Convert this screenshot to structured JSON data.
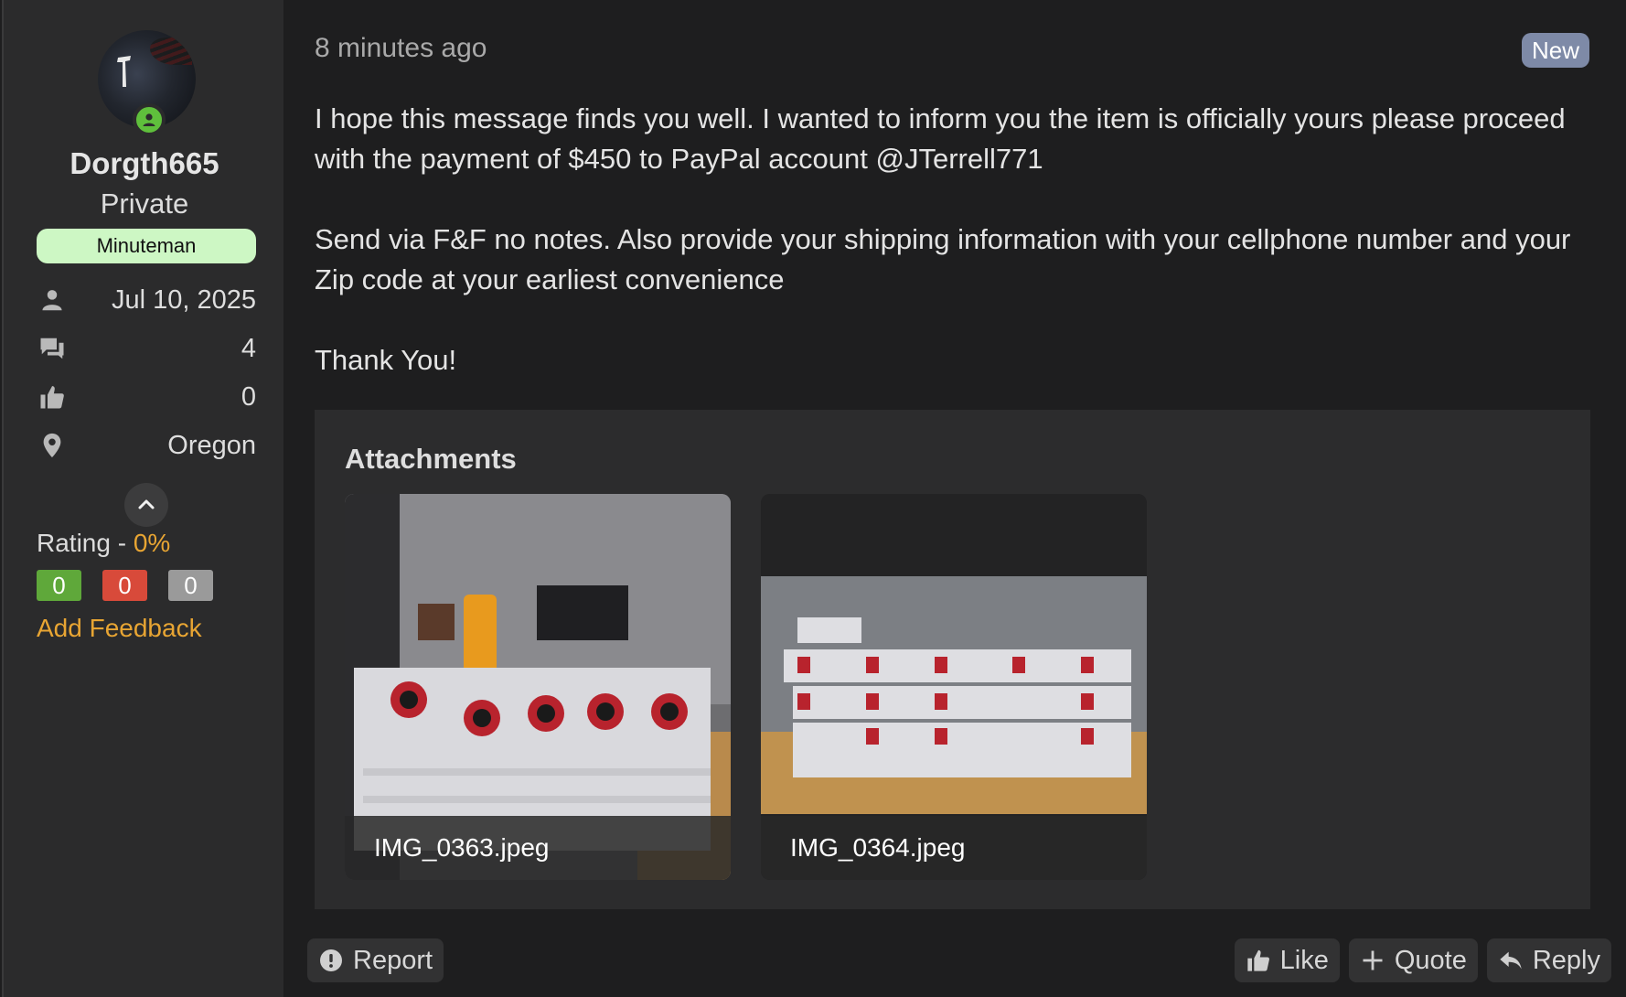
{
  "user": {
    "username": "Dorgth665",
    "user_title": "Private",
    "rank_badge": "Minuteman",
    "stats": [
      {
        "icon": "person-icon",
        "value": "Jul 10, 2025"
      },
      {
        "icon": "messages-icon",
        "value": "4"
      },
      {
        "icon": "thumbs-up-icon",
        "value": "0"
      },
      {
        "icon": "location-pin-icon",
        "value": "Oregon"
      }
    ],
    "rating_label": "Rating - ",
    "rating_percent": "0%",
    "feedback": {
      "positive": "0",
      "negative": "0",
      "neutral": "0"
    },
    "add_feedback_label": "Add Feedback"
  },
  "post": {
    "timestamp": "8 minutes ago",
    "new_badge": "New",
    "paragraphs": [
      "I hope this message finds you well. I wanted to inform you the item is officially yours please proceed with the payment of $450 to PayPal account @JTerrell771",
      "Send via F&F no notes. Also provide your shipping information with your cellphone number and your Zip code at your earliest convenience",
      "Thank You!"
    ],
    "attachments_title": "Attachments",
    "attachments": [
      {
        "filename": "IMG_0363.jpeg"
      },
      {
        "filename": "IMG_0364.jpeg"
      }
    ]
  },
  "actions": {
    "report_label": "Report",
    "like_label": "Like",
    "quote_label": "Quote",
    "reply_label": "Reply"
  },
  "colors": {
    "accent_orange": "#e8a533",
    "online_green": "#5fbf3c",
    "rank_badge_bg": "#cdf7c4",
    "new_badge_bg": "#7e8aa7"
  }
}
